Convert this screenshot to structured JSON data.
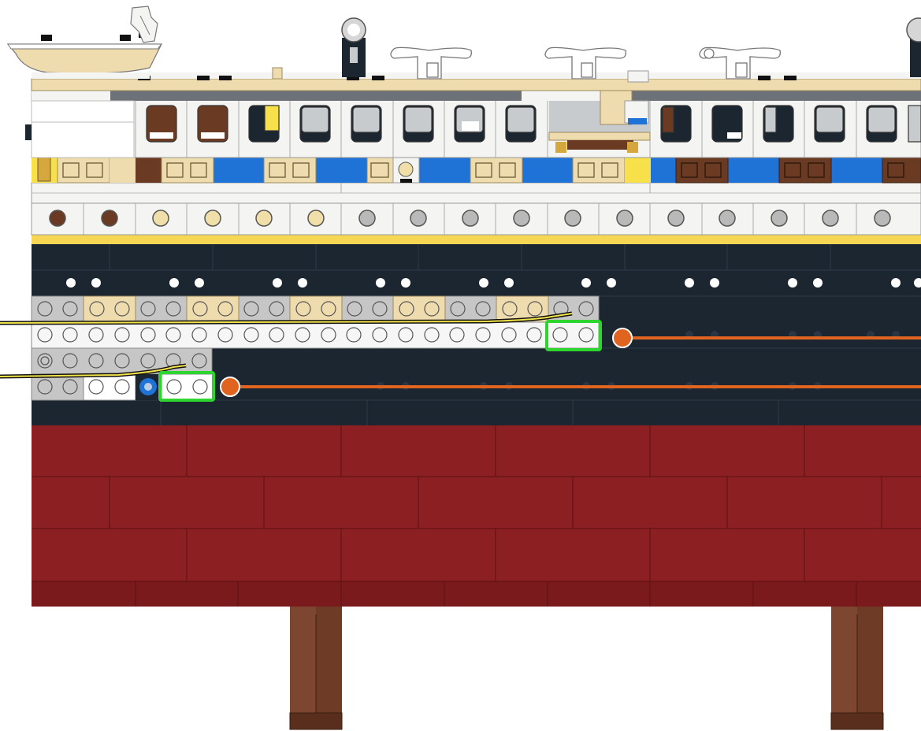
{
  "colors": {
    "background": "#ffffff",
    "hull_red": "#8b1f22",
    "hull_black": "#1b2631",
    "deck_white": "#f4f4f2",
    "tan": "#efdcae",
    "light_gray": "#c6c6c6",
    "dark_gray": "#6d7278",
    "blue_stripe": "#1f72d6",
    "yellow": "#f8e04b",
    "brown": "#6b3a22",
    "stand_brown": "#6e3b26",
    "highlight_green": "#2fd52f",
    "marker_orange": "#e0641f",
    "guide_yellow": "#f2e24a"
  },
  "instruction_callouts": [
    {
      "name": "upper-row-callout",
      "marker": "orange-dot",
      "highlight": "green-box"
    },
    {
      "name": "lower-row-callout",
      "marker": "orange-dot",
      "highlight": "green-box"
    }
  ],
  "icons": [
    "lifeboat-icon",
    "ventilator-icon",
    "crane-icon",
    "lamp-icon",
    "porthole-icon",
    "stud-icon"
  ]
}
